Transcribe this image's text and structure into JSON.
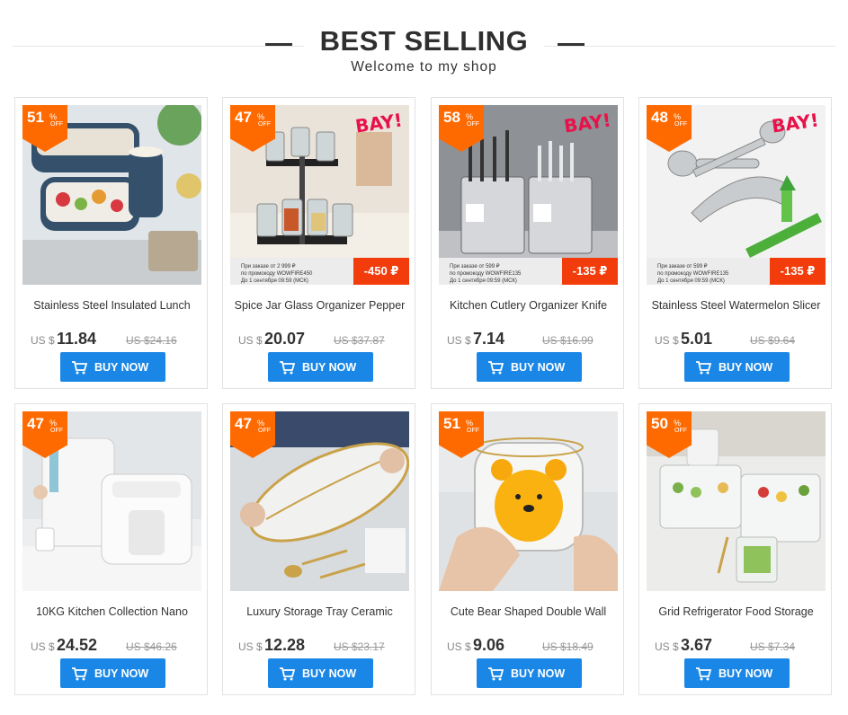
{
  "header": {
    "title": "BEST SELLING",
    "subtitle": "Welcome to my shop"
  },
  "accent": "#ff6a00",
  "button_color": "#1a87e6",
  "products": [
    {
      "discount": "51",
      "pct_sign": "%",
      "off": "OFF",
      "name": "Stainless Steel Insulated Lunch",
      "currency": "US $",
      "price": "11.84",
      "old_price": "US $24.16",
      "buy_label": "BUY NOW",
      "image": "lunch-box"
    },
    {
      "discount": "47",
      "pct_sign": "%",
      "off": "OFF",
      "name": "Spice Jar Glass Organizer Pepper",
      "currency": "US $",
      "price": "20.07",
      "old_price": "US $37.87",
      "buy_label": "BUY NOW",
      "image": "spice-rack",
      "bay": "BAY!",
      "promo_line1": "При заказе от 2 999 ₽",
      "promo_line2": "по промокоду WOWFIRE450",
      "promo_line3": "До 1 сентября 09:59 (МСК)",
      "promo_price": "-450 ₽"
    },
    {
      "discount": "58",
      "pct_sign": "%",
      "off": "OFF",
      "name": "Kitchen Cutlery Organizer Knife",
      "currency": "US $",
      "price": "7.14",
      "old_price": "US $16.99",
      "buy_label": "BUY NOW",
      "image": "cutlery-holder",
      "bay": "BAY!",
      "promo_line1": "При заказе от 599 ₽",
      "promo_line2": "по промокоду WOWFIRE135",
      "promo_line3": "До 1 сентября 09:59 (МСК)",
      "promo_price": "-135 ₽"
    },
    {
      "discount": "48",
      "pct_sign": "%",
      "off": "OFF",
      "name": "Stainless Steel Watermelon Slicer",
      "currency": "US $",
      "price": "5.01",
      "old_price": "US $9.64",
      "buy_label": "BUY NOW",
      "image": "melon-slicer",
      "bay": "BAY!",
      "promo_line1": "При заказе от 599 ₽",
      "promo_line2": "по промокоду WOWFIRE135",
      "promo_line3": "До 1 сентября 09:59 (МСК)",
      "promo_price": "-135 ₽"
    },
    {
      "discount": "47",
      "pct_sign": "%",
      "off": "OFF",
      "name": "10KG Kitchen Collection Nano",
      "currency": "US $",
      "price": "24.52",
      "old_price": "US $46.26",
      "buy_label": "BUY NOW",
      "image": "rice-dispenser"
    },
    {
      "discount": "47",
      "pct_sign": "%",
      "off": "OFF",
      "name": "Luxury Storage Tray Ceramic",
      "currency": "US $",
      "price": "12.28",
      "old_price": "US $23.17",
      "buy_label": "BUY NOW",
      "image": "leaf-tray"
    },
    {
      "discount": "51",
      "pct_sign": "%",
      "off": "OFF",
      "name": "Cute Bear Shaped Double Wall",
      "currency": "US $",
      "price": "9.06",
      "old_price": "US $18.49",
      "buy_label": "BUY NOW",
      "image": "bear-glass"
    },
    {
      "discount": "50",
      "pct_sign": "%",
      "off": "OFF",
      "name": "Grid Refrigerator Food Storage",
      "currency": "US $",
      "price": "3.67",
      "old_price": "US $7.34",
      "buy_label": "BUY NOW",
      "image": "food-containers"
    }
  ]
}
